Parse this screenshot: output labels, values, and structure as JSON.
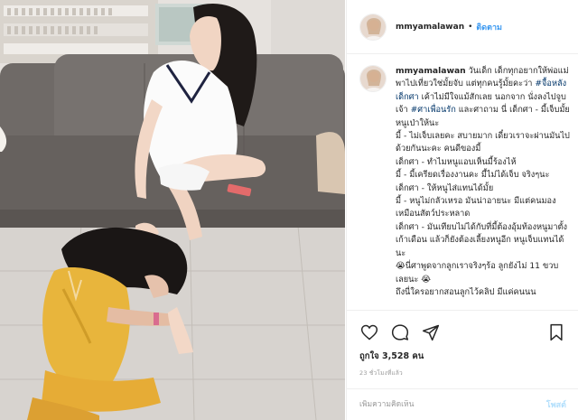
{
  "post": {
    "username": "mmyamalawan",
    "follow_label": "ติดตาม",
    "header_separator": "•",
    "caption": {
      "username": "mmyamalawan",
      "text_1": " วันเด็ก เด็กทุกอยากให้พ่อแม่พาไปเที่ยวใช่มั้ยจับ แต่ทุกคนรู้มั้ยคะว่า ",
      "tag_1": "#จื้อหลังเด็กศา",
      "text_2": " เค้าไม่มีใจแม้สักเลย นอกจาก นั่งลงไปจูบเจ้า ",
      "tag_2": "#ศาเพื่อนรัก",
      "text_3": " และศาถาม นี่ เด็กศา - มี้เจ็บมั้ย หนูเป่าให้นะ\nมี้ - ไม่เจ็บเลยคะ สบายมาก เดี๋ยวเราจะผ่านมันไปด้วยกันนะคะ คนดีของมี้\nเด็กศา - ทำไมหนูแอบเห็นมี้ร้องไห้\nมี้ - มี้เครียดเรื่องงานคะ มี้ไม่ได้เจ็บ จริงๆนะ\nเด็กศา - ให้หนูไส่แทนได้มั้ย\nมี้ - หนูไม่กลัวเหรอ มันน่าอายนะ มีแต่คนมอง เหมือนสัตว์ประหลาด\nเด็กศา - มันเทียบไม่ได้กับที่มี้ต้องอุ้มท้องหนูมาตั้งเก้าเดือน แล้วก็ยังต้องเลี้ยงหนูอีก หนูเจ็บแทนได้นะ\n😭นี่ศาพูดจากลูกเราจริงๆร้อ ลูกยังไม่ 11 ขวบเลยนะ 😭\nถึงนี่ใครอยากสอนลูกไว้คลิป มีแค่คนนน"
    },
    "likes_label": "ถูกใจ 3,528 คน",
    "time_label": "23 ชั่วโมงที่แล้ว",
    "comment_placeholder": "เพิ่มความคิดเห็น",
    "post_label": "โพสต์"
  },
  "icons": {
    "like": "heart-icon",
    "comment": "speech-bubble-icon",
    "share": "paper-plane-icon",
    "save": "bookmark-icon"
  },
  "colors": {
    "link": "#3897f0",
    "hashtag": "#003569",
    "post_disabled": "#b2dffc",
    "border": "#efefef"
  }
}
